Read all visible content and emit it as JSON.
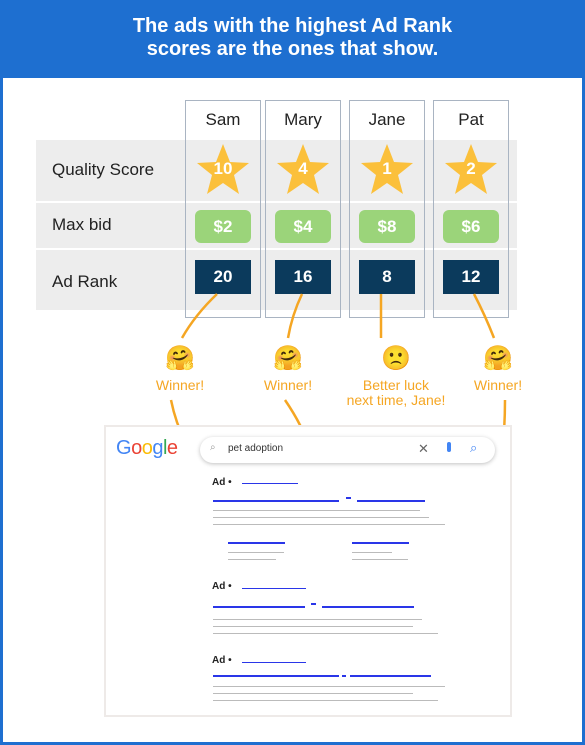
{
  "title": "The ads with the highest Ad Rank scores are the ones that show.",
  "title_lines": [
    "The ads with the highest Ad Rank",
    "scores are the ones that show."
  ],
  "rows": [
    "Quality Score",
    "Max bid",
    "Ad Rank"
  ],
  "advertisers": [
    {
      "name": "Sam",
      "quality_score": "10",
      "max_bid": "$2",
      "ad_rank": "20",
      "result": "Winner!",
      "emoji": "🤗"
    },
    {
      "name": "Mary",
      "quality_score": "4",
      "max_bid": "$4",
      "ad_rank": "16",
      "result": "Winner!",
      "emoji": "🤗"
    },
    {
      "name": "Jane",
      "quality_score": "1",
      "max_bid": "$8",
      "ad_rank": "8",
      "result": "Better luck next time, Jane!",
      "result_lines": [
        "Better luck",
        "next time, Jane!"
      ],
      "emoji": "🙁"
    },
    {
      "name": "Pat",
      "quality_score": "2",
      "max_bid": "$6",
      "ad_rank": "12",
      "result": "Winner!",
      "emoji": "🤗"
    }
  ],
  "search": {
    "logo": "Google",
    "query": "pet adoption",
    "ad_label": "Ad •",
    "icons": [
      "search-icon",
      "clear-icon",
      "microphone-icon",
      "search-button-icon"
    ]
  },
  "colors": {
    "header": "#1e6fd0",
    "star": "#fbc03b",
    "bid": "#9bd47a",
    "rank": "#0b3a5c",
    "connector": "#f5a623"
  }
}
